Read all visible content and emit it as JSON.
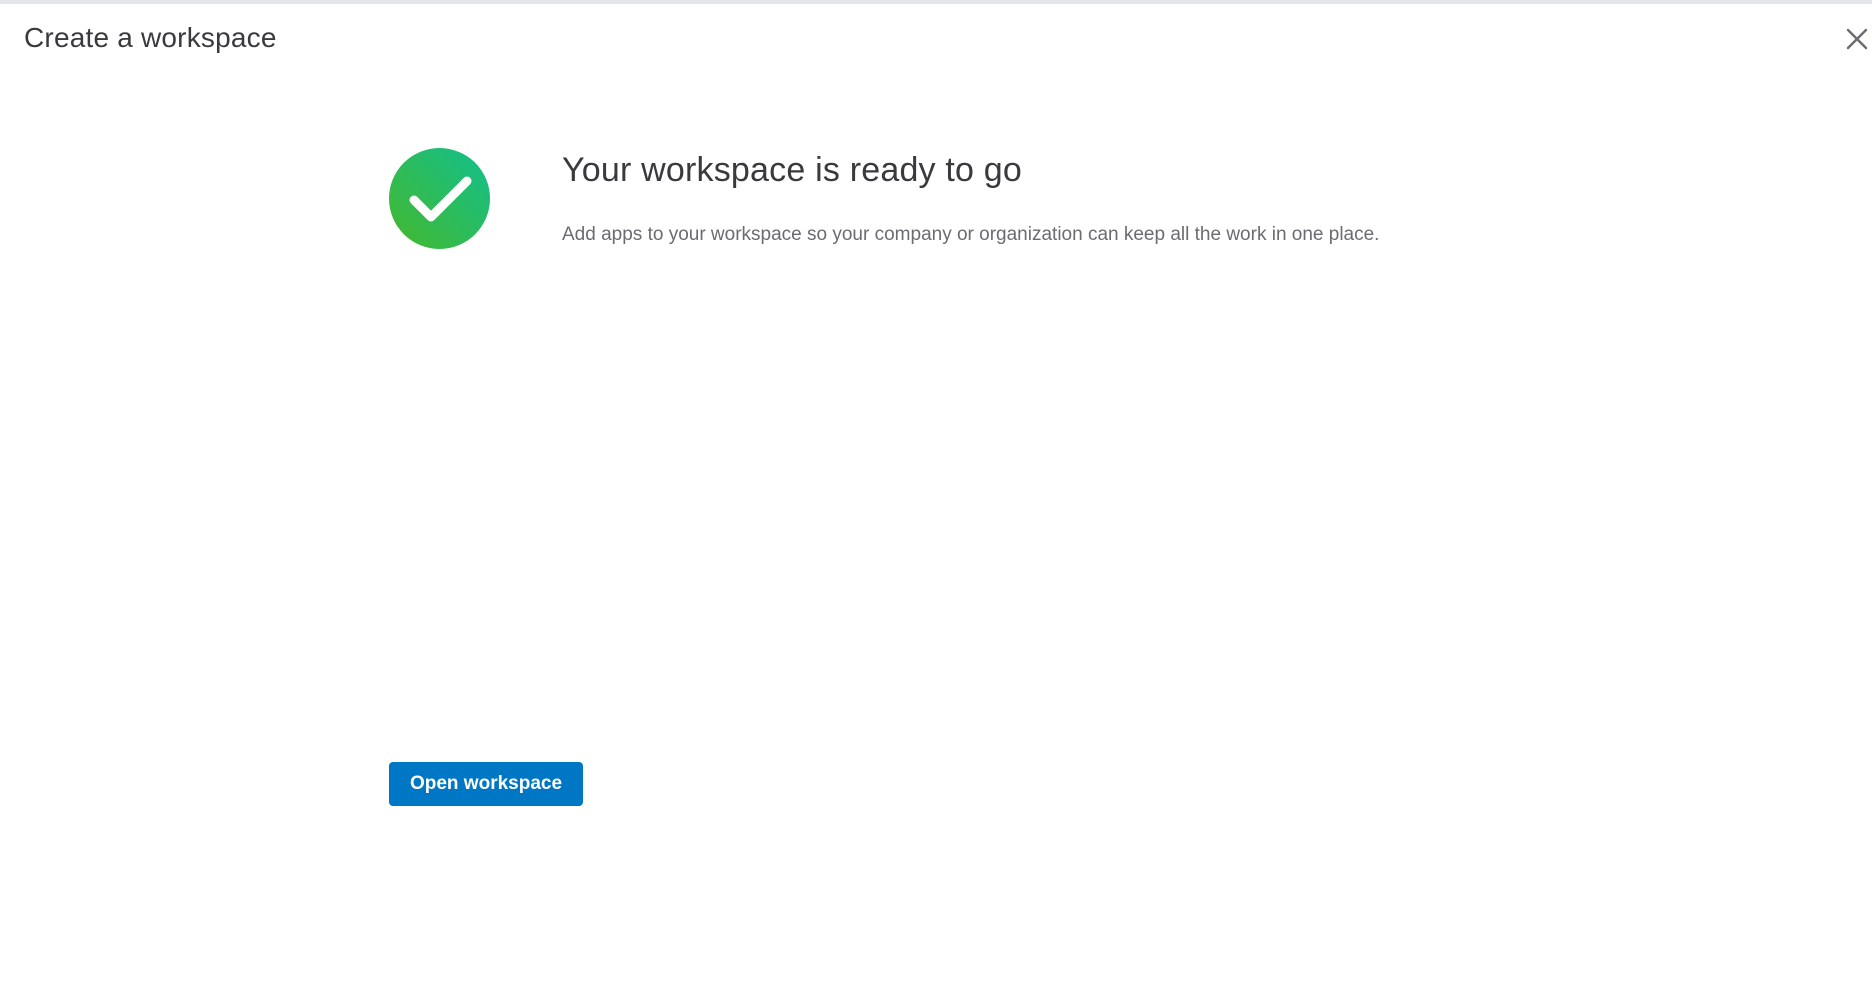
{
  "dialog": {
    "title": "Create a workspace",
    "close_icon": "close-icon"
  },
  "success": {
    "icon": "check-circle-icon",
    "heading": "Your workspace is ready to go",
    "description": "Add apps to your workspace so your company or organization can keep all the work in one place."
  },
  "actions": {
    "open_workspace_label": "Open workspace"
  },
  "colors": {
    "primary_button": "#0077c5",
    "success_gradient_start": "#45b82c",
    "success_gradient_end": "#11bf8e",
    "title_text": "#393a3d",
    "description_text": "#6b6c72"
  }
}
